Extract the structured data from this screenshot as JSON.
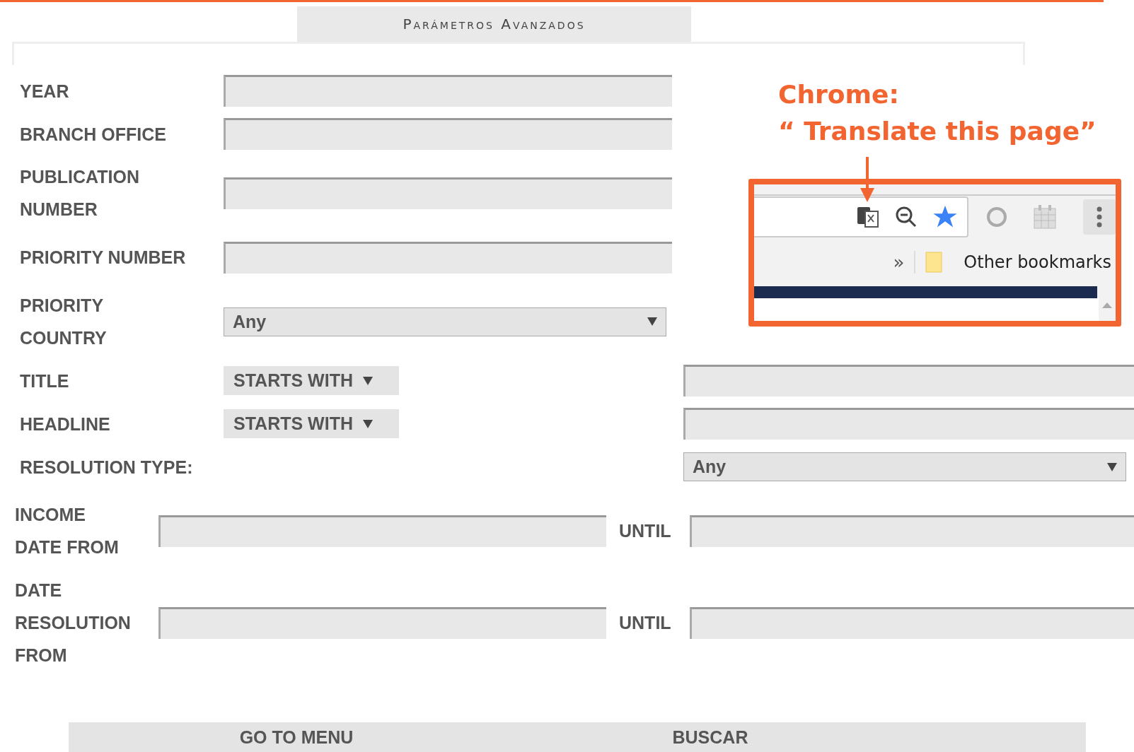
{
  "header": {
    "title": "Parámetros Avanzados"
  },
  "rows": [
    {
      "kind": "text",
      "label": [
        "YEAR"
      ]
    },
    {
      "kind": "text",
      "label": [
        "BRANCH OFFICE"
      ]
    },
    {
      "kind": "text",
      "label": [
        "PUBLICATION",
        "NUMBER"
      ]
    },
    {
      "kind": "text",
      "label": [
        "PRIORITY NUMBER"
      ]
    },
    {
      "kind": "select",
      "label": [
        "PRIORITY",
        "COUNTRY"
      ],
      "value": "Any"
    },
    {
      "kind": "condition",
      "label": [
        "TITLE"
      ],
      "value": "STARTS WITH"
    },
    {
      "kind": "condition",
      "label": [
        "HEADLINE"
      ],
      "value": "STARTS WITH"
    },
    {
      "kind": "select_wide",
      "label": [
        "RESOLUTION TYPE:"
      ],
      "value": "Any"
    },
    {
      "kind": "range",
      "label": [
        "INCOME",
        "DATE FROM"
      ],
      "until": "UNTIL"
    },
    {
      "kind": "range",
      "label": [
        "DATE",
        "RESOLUTION",
        "FROM"
      ],
      "until": "UNTIL"
    }
  ],
  "buttons": [
    "GO TO MENU",
    "BUSCAR"
  ],
  "annotation": {
    "title": "Chrome:",
    "caption": "“ Translate this page”"
  },
  "browser_toolbar": {
    "overflow": "»",
    "bookmark_folder": "Other bookmarks"
  }
}
